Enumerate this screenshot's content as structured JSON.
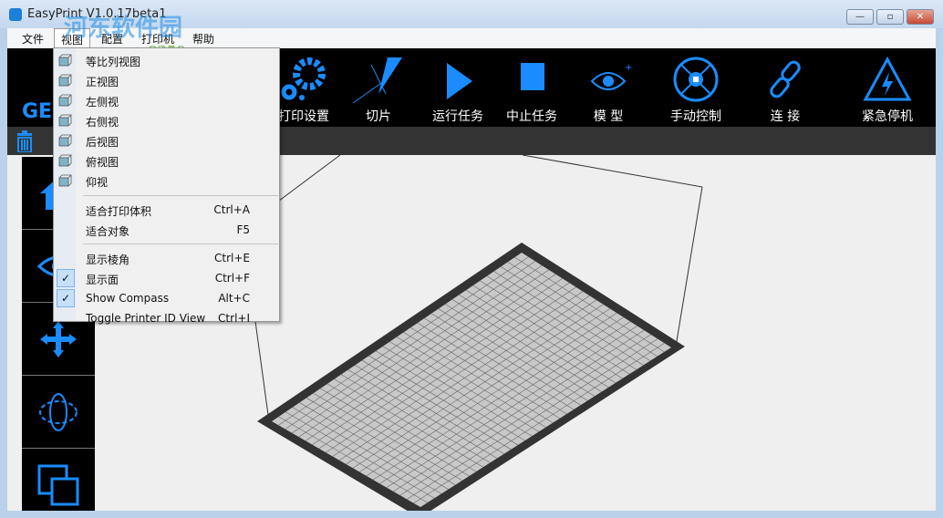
{
  "window": {
    "title": "EasyPrint   V1.0.17beta1",
    "minimize": "—",
    "maximize": "▫",
    "close": "✕"
  },
  "menubar": {
    "items": [
      "文件",
      "视图",
      "配置",
      "打印机",
      "帮助"
    ]
  },
  "logo": "GEO",
  "toolbar": {
    "items": [
      {
        "label": "打印设置",
        "icon": "gears-icon"
      },
      {
        "label": "切片",
        "icon": "slice-icon"
      },
      {
        "label": "运行任务",
        "icon": "play-icon"
      },
      {
        "label": "中止任务",
        "icon": "stop-icon"
      },
      {
        "label": "模 型",
        "icon": "eye-icon"
      },
      {
        "label": "手动控制",
        "icon": "manual-control-icon"
      },
      {
        "label": "连 接",
        "icon": "link-icon"
      },
      {
        "label": "紧急停机",
        "icon": "emergency-stop-icon"
      }
    ]
  },
  "view_menu": {
    "views": [
      "等比列视图",
      "正视图",
      "左侧视",
      "右侧视",
      "后视图",
      "俯视图",
      "仰视"
    ],
    "fit": [
      {
        "label": "适合打印体积",
        "shortcut": "Ctrl+A"
      },
      {
        "label": "适合对象",
        "shortcut": "F5"
      }
    ],
    "toggles": [
      {
        "label": "显示棱角",
        "shortcut": "Ctrl+E",
        "checked": false
      },
      {
        "label": "显示面",
        "shortcut": "Ctrl+F",
        "checked": true
      },
      {
        "label": "Show Compass",
        "shortcut": "Alt+C",
        "checked": true
      },
      {
        "label": "Toggle Printer ID View",
        "shortcut": "Ctrl+I",
        "checked": false
      }
    ]
  },
  "left_panel": [
    "home-icon",
    "eye-icon",
    "move-icon",
    "rotate-icon",
    "scale-icon"
  ],
  "watermark": {
    "text": "河东软件园",
    "url": "www.pc0359.cn"
  },
  "colors": {
    "accent": "#1a8cff",
    "toolbar": "#000000",
    "subbar": "#333333",
    "viewport": "#efefef",
    "bed": "#333333"
  }
}
